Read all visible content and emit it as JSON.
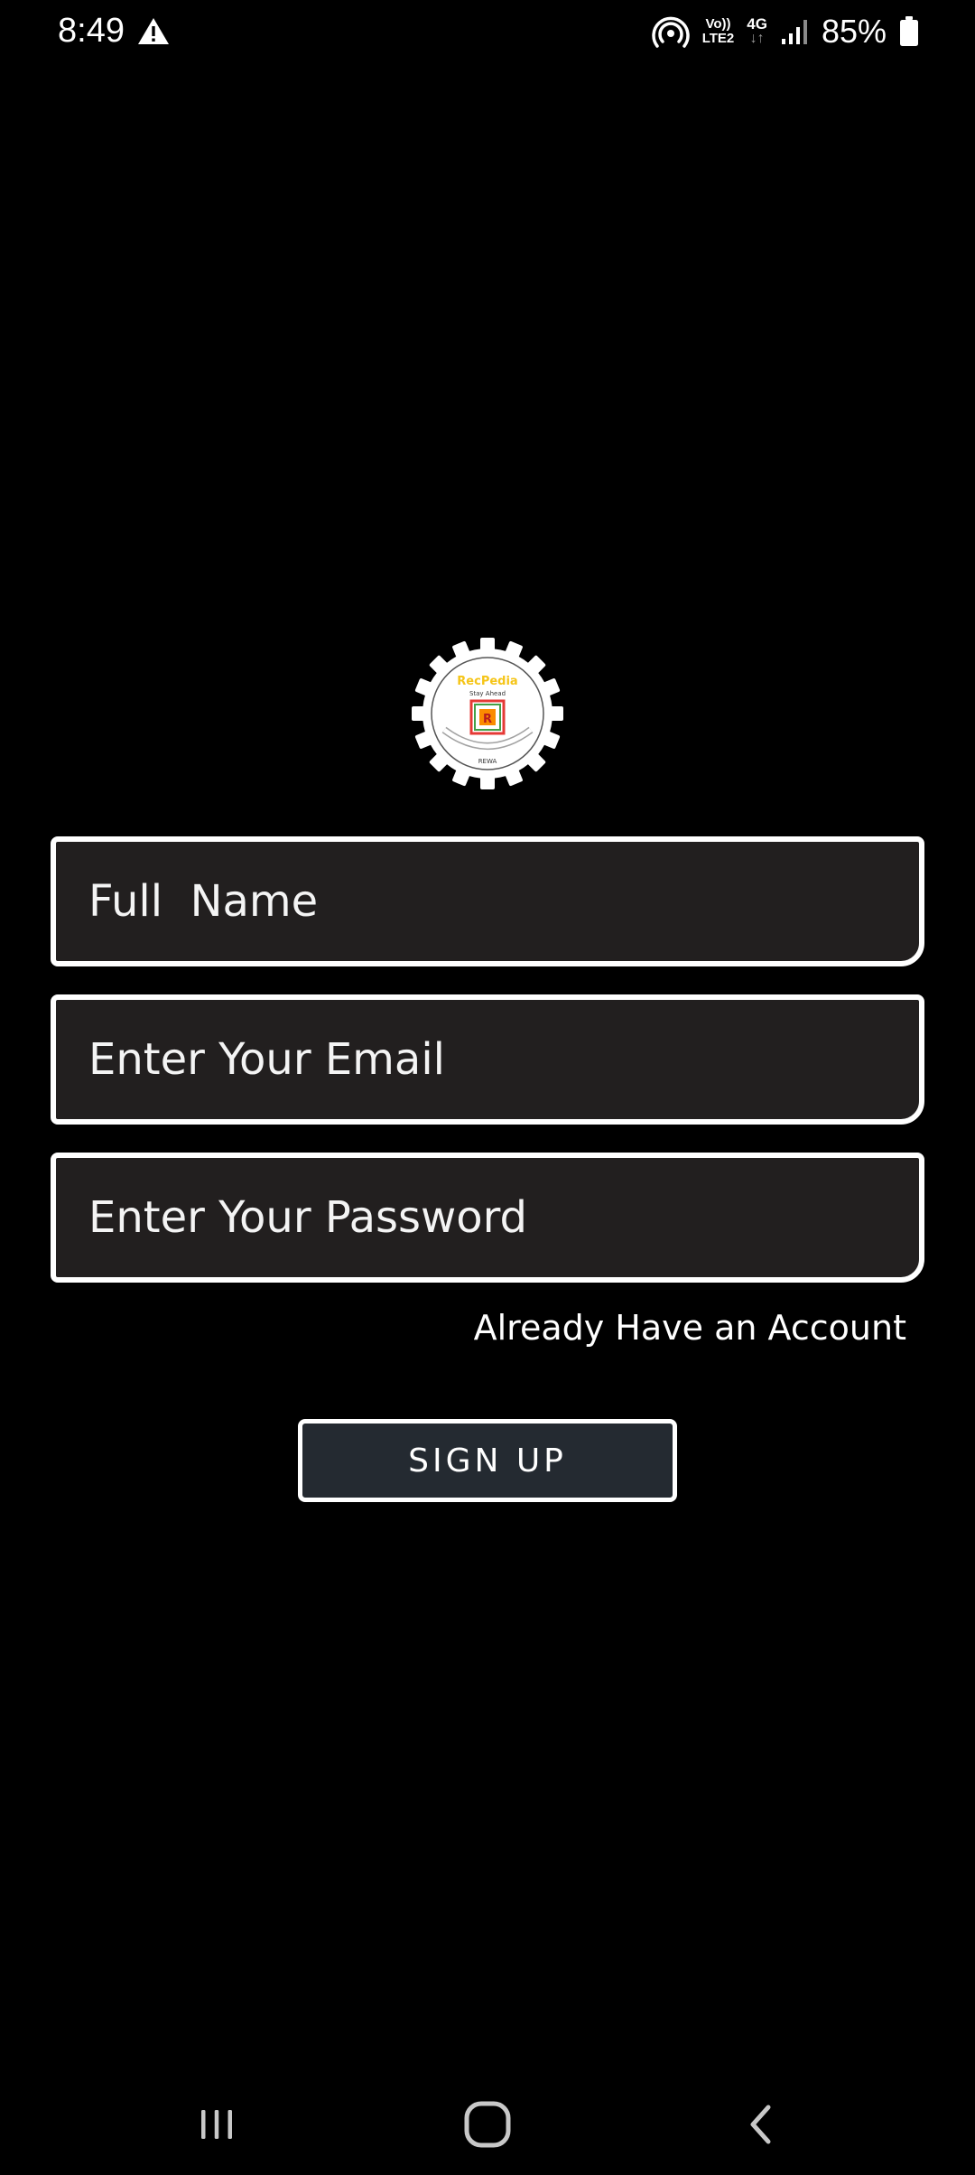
{
  "status_bar": {
    "time": "8:49",
    "volte_line1": "Vo))",
    "volte_line2": "LTE2",
    "network": "4G",
    "network_arrows": "↓↑",
    "battery_percent": "85%",
    "icons": [
      "warning-icon",
      "hotspot-icon",
      "signal-icon",
      "battery-icon"
    ]
  },
  "logo": {
    "brand": "RecPedia",
    "tagline": "Stay Ahead",
    "letter": "R",
    "location": "REWA",
    "colors": {
      "brand_text": "#f5c518",
      "square_red": "#e53935",
      "square_green": "#43a047",
      "square_blue": "#1e88e5",
      "square_orange": "#fb8c00"
    }
  },
  "form": {
    "full_name_placeholder": "Full  Name",
    "email_placeholder": "Enter Your Email",
    "password_placeholder": "Enter Your Password",
    "full_name_value": "",
    "email_value": "",
    "password_value": ""
  },
  "already_account_link": "Already Have an Account",
  "signup_button": "SIGN UP",
  "nav_bar": {
    "items": [
      "recents-icon",
      "home-icon",
      "back-icon"
    ]
  },
  "colors": {
    "background": "#000000",
    "field_fill": "#221f1f",
    "field_border": "#ffffff",
    "button_fill": "#242a31",
    "text": "#ffffff"
  }
}
